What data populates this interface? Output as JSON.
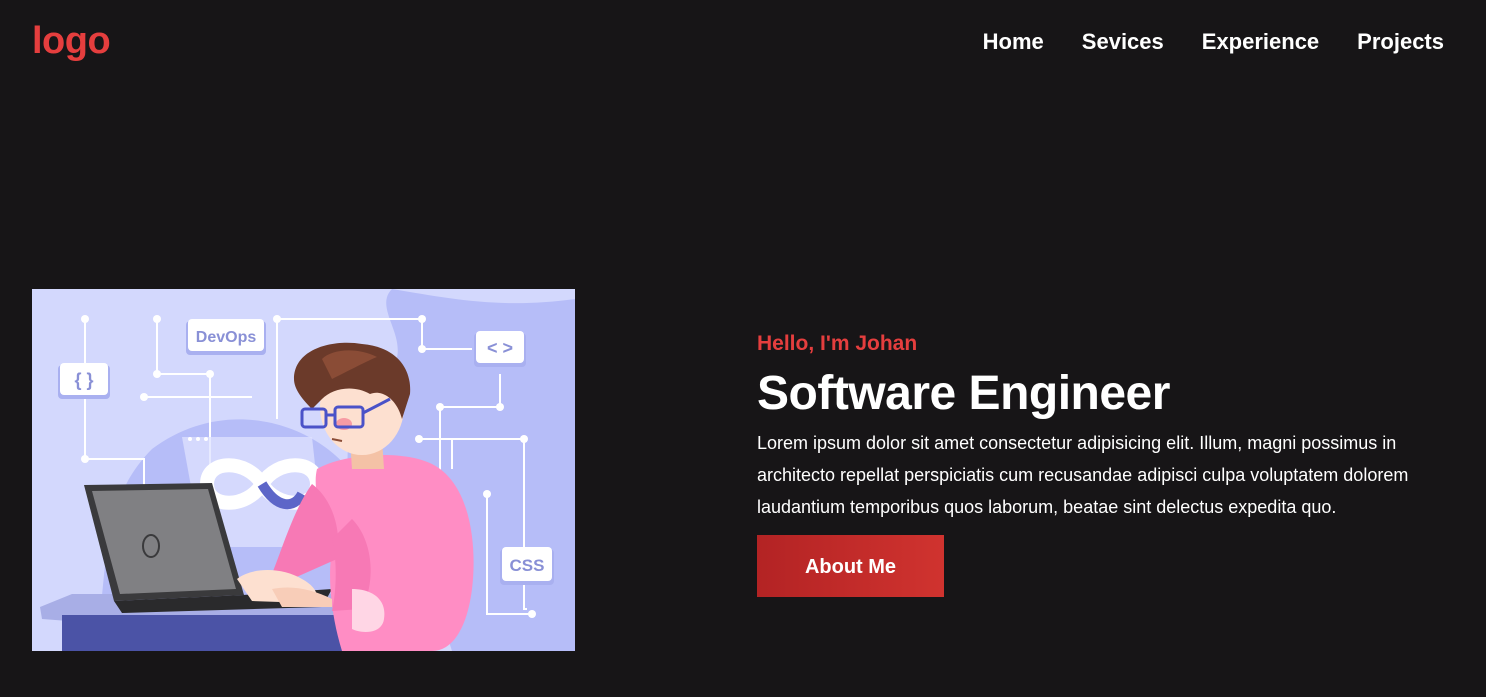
{
  "header": {
    "logo": "logo",
    "nav": [
      {
        "label": "Home"
      },
      {
        "label": "Sevices"
      },
      {
        "label": "Experience"
      },
      {
        "label": "Projects"
      }
    ]
  },
  "hero": {
    "greeting": "Hello, I'm Johan",
    "title": "Software Engineer",
    "description": "Lorem ipsum dolor sit amet consectetur adipisicing elit. Illum, magni possimus in architecto repellat perspiciatis cum recusandae adipisci culpa voluptatem dolorem laudantium temporibus quos laborum, beatae sint delectus expedita quo.",
    "button_label": "About Me",
    "illustration": {
      "badge_devops": "DevOps",
      "badge_braces": "{ }",
      "badge_code": "< >",
      "badge_css": "CSS"
    }
  },
  "colors": {
    "background": "#171517",
    "accent": "#e53e3e",
    "button_start": "#b32324",
    "button_end": "#d0332f",
    "illustration_bg": "#c5cbfb"
  }
}
